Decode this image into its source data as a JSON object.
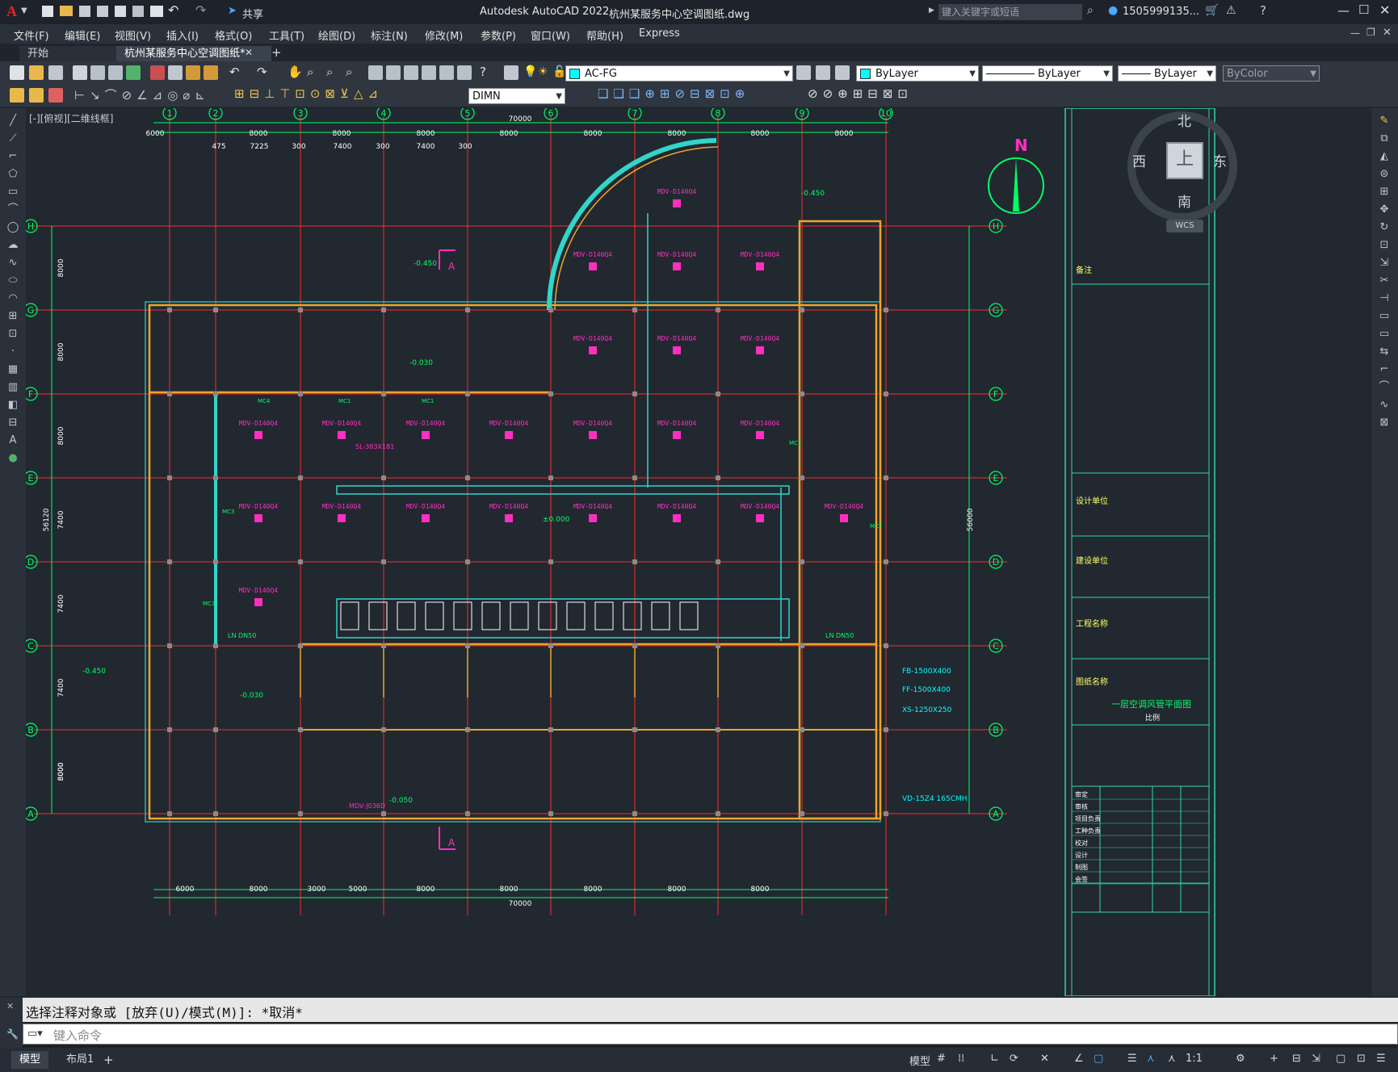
{
  "app": {
    "title": "Autodesk AutoCAD 2022",
    "filename": "杭州某服务中心空调图纸.dwg",
    "share_label": "共享",
    "search_placeholder": "键入关键字或短语",
    "user": "1505999135..."
  },
  "menu": [
    "文件(F)",
    "编辑(E)",
    "视图(V)",
    "插入(I)",
    "格式(O)",
    "工具(T)",
    "绘图(D)",
    "标注(N)",
    "修改(M)",
    "参数(P)",
    "窗口(W)",
    "帮助(H)",
    "Express"
  ],
  "tabs": [
    {
      "label": "开始"
    },
    {
      "label": "杭州某服务中心空调图纸*"
    }
  ],
  "toolbar": {
    "layer": "AC-FG",
    "color": "ByLayer",
    "linetype": "ByLayer",
    "lineweight": "ByLayer",
    "plotstyle": "ByColor",
    "dimstyle": "DIMN"
  },
  "viewport_label": "[-][俯视][二维线框]",
  "viewcube": {
    "north": "北",
    "south": "南",
    "east": "东",
    "west": "西",
    "top": "上",
    "wcs": "WCS"
  },
  "north_arrow": "N",
  "drawing": {
    "grid_columns": [
      "1",
      "2",
      "3",
      "4",
      "5",
      "6",
      "7",
      "8",
      "9",
      "10"
    ],
    "grid_rows": [
      "H",
      "G",
      "F",
      "E",
      "D",
      "C",
      "B",
      "A"
    ],
    "top_total": "70000",
    "bottom_total": "70000",
    "top_spans": [
      "6000",
      "8000",
      "8000",
      "8000",
      "8000",
      "8000",
      "8000",
      "8000",
      "8000"
    ],
    "top_sub": [
      "475",
      "7225",
      "300",
      "7400",
      "300",
      "7400",
      "300"
    ],
    "bottom_spans": [
      "6000",
      "8000",
      "3000",
      "5000",
      "8000",
      "8000",
      "8000",
      "8000",
      "8000"
    ],
    "left_total": "56120",
    "right_total": "56000",
    "left_spans": [
      "8000",
      "8000",
      "8000",
      "7400",
      "7400",
      "7400",
      "8000",
      "8000"
    ],
    "units": [
      "MDV-D140Q4",
      "MDV-D140Q4",
      "MDV-D140Q4",
      "MDV-D140Q4",
      "MDV-D140Q4",
      "MDV-D140Q4",
      "MDV-D140Q4"
    ],
    "unit_label": "MDV-D140Q4",
    "labels": {
      "lev1": "-0.450",
      "lev2": "-0.030",
      "lev3": "±0.000",
      "lev4": "-0.050",
      "fb": "FB-1500X400",
      "ff": "FF-1500X400",
      "xs": "XS-1250X250",
      "vd": "VD-15Z4 165CMH",
      "ln": "LN DN50",
      "sl": "SL-383X181",
      "mc1": "MC1",
      "mc2": "MC2",
      "mc3": "MC3",
      "mc4": "MC4",
      "sec_a": "A",
      "mdv_j": "MDV-J036D"
    }
  },
  "titleblock": {
    "remark": "备注",
    "design_unit": "设计单位",
    "build_unit": "建设单位",
    "project": "工程名称",
    "drawing_name": "图纸名称",
    "title": "一层空调风管平面图",
    "scale": "比例",
    "roles": [
      "审定",
      "审核",
      "项目负责",
      "工种负责",
      "校对",
      "设计",
      "制图",
      "会签"
    ]
  },
  "command": {
    "history": "选择注释对象或 [放弃(U)/模式(M)]: *取消*",
    "placeholder": "键入命令"
  },
  "status": {
    "model": "模型",
    "layout1": "布局1",
    "add": "+",
    "mode": "模型",
    "scale": "1:1"
  }
}
